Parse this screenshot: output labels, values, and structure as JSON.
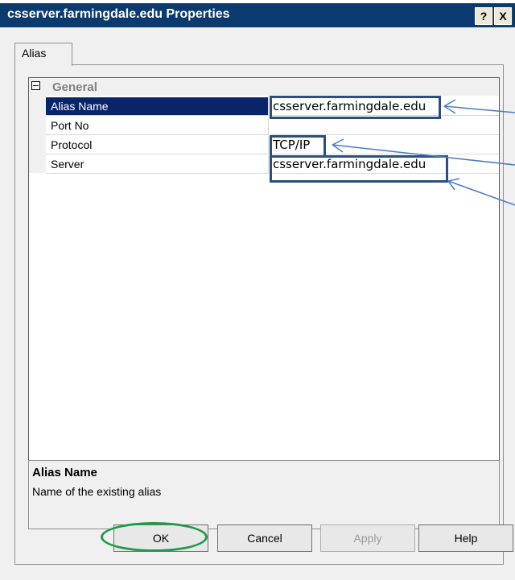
{
  "window": {
    "title": "csserver.farmingdale.edu Properties",
    "help_label": "?",
    "close_label": "X"
  },
  "tabs": [
    {
      "label": "Alias"
    }
  ],
  "property_grid": {
    "category": "General",
    "rows": [
      {
        "name": "Alias Name",
        "value": "csserver.farmingdale.edu",
        "selected": true
      },
      {
        "name": "Port No",
        "value": ""
      },
      {
        "name": "Protocol",
        "value": "TCP/IP"
      },
      {
        "name": "Server",
        "value": "csserver.farmingdale.edu"
      }
    ]
  },
  "description": {
    "title": "Alias Name",
    "text": "Name of the existing alias"
  },
  "buttons": {
    "ok": "OK",
    "cancel": "Cancel",
    "apply": "Apply",
    "help": "Help"
  },
  "annotation_colors": {
    "highlight_box": "#2b4f80",
    "arrow": "#4a7cbf",
    "ok_circle": "#1f9a48",
    "selection": "#0a246a"
  }
}
